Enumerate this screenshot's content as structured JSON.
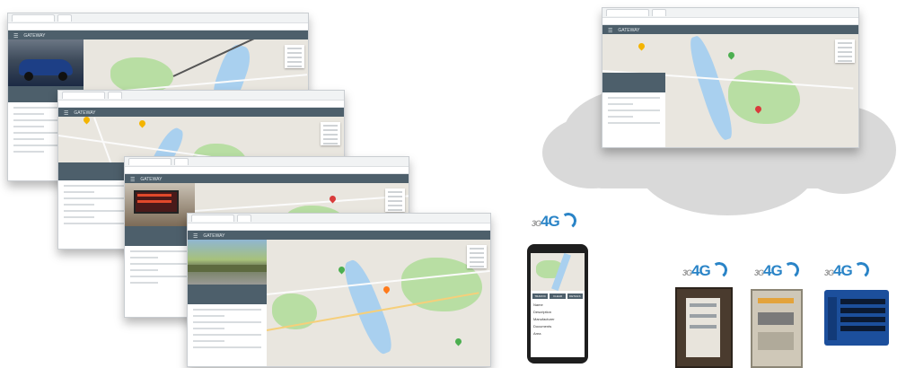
{
  "windows": [
    {
      "app_title": "GATEWAY",
      "window": "win1"
    },
    {
      "app_title": "GATEWAY",
      "window": "win2"
    },
    {
      "app_title": "GATEWAY",
      "window": "win3"
    },
    {
      "app_title": "GATEWAY",
      "window": "win4"
    },
    {
      "app_title": "GATEWAY",
      "window": "win-cloud"
    }
  ],
  "phone": {
    "buttons": [
      "TRAFFIC",
      "CLEAR",
      "DETAILS"
    ],
    "labels": [
      "Name",
      "Description",
      "Manufacturer",
      "Documents",
      "Area"
    ]
  },
  "network_tag": {
    "prefix": "3G",
    "main": "4G"
  },
  "colors": {
    "appbar": "#4d5f6b",
    "map_bg": "#e9e6df",
    "park": "#b8dea3",
    "river": "#a9d0ef",
    "cloud": "#d9d9d9",
    "brand_4g": "#2a84c7"
  }
}
